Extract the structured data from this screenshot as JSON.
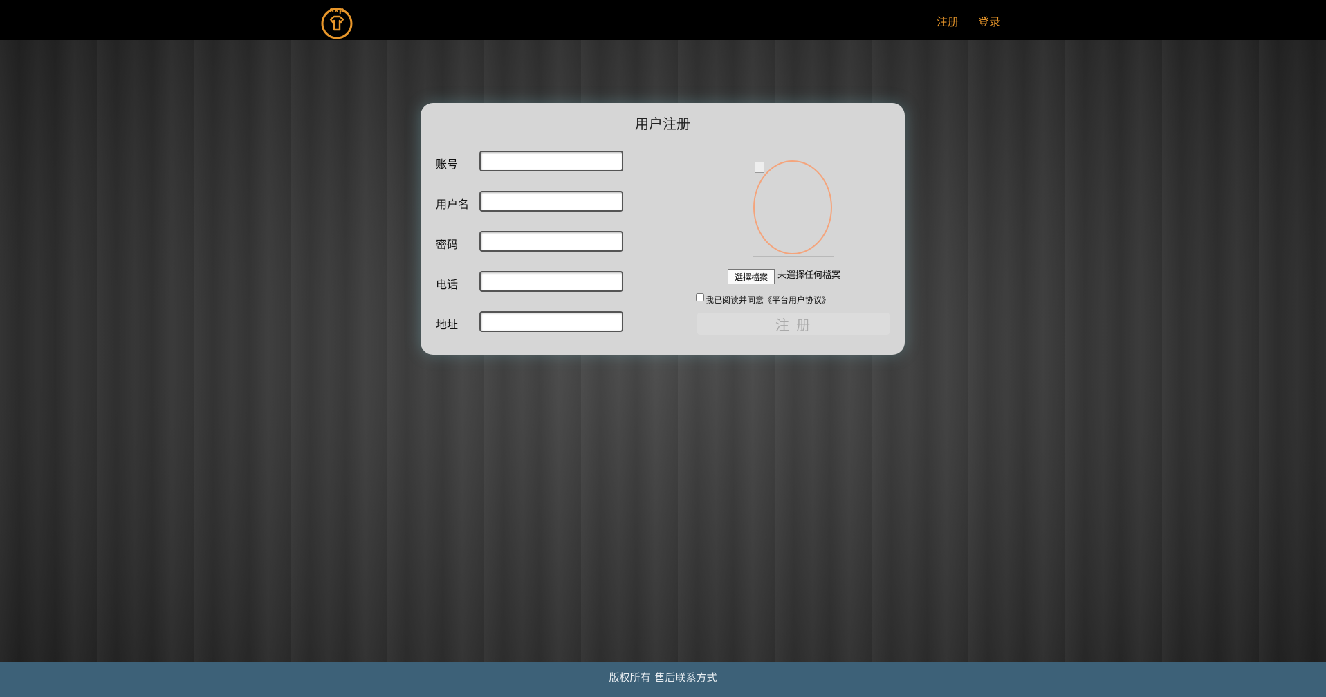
{
  "header": {
    "logo_text": "sxp",
    "nav": {
      "register": "注册",
      "login": "登录"
    }
  },
  "form": {
    "title": "用户注册",
    "fields": [
      {
        "label": "账号",
        "value": "",
        "placeholder": ""
      },
      {
        "label": "用户名",
        "value": "",
        "placeholder": ""
      },
      {
        "label": "密码",
        "value": "",
        "placeholder": ""
      },
      {
        "label": "电话",
        "value": "",
        "placeholder": ""
      },
      {
        "label": "地址",
        "value": "",
        "placeholder": ""
      }
    ],
    "file_button": "選擇檔案",
    "file_status": "未選擇任何檔案",
    "agreement": "我已阅读并同意《平台用户协议》",
    "agreement_checked": false,
    "submit": "注 册"
  },
  "footer": {
    "copyright": "版权所有",
    "contact": "售后联系方式"
  },
  "colors": {
    "topbar": "#000000",
    "nav_link": "#e8962a",
    "card": "#d6d6d6",
    "avatar_ring": "#f4a47c",
    "footer": "#3d6178"
  }
}
